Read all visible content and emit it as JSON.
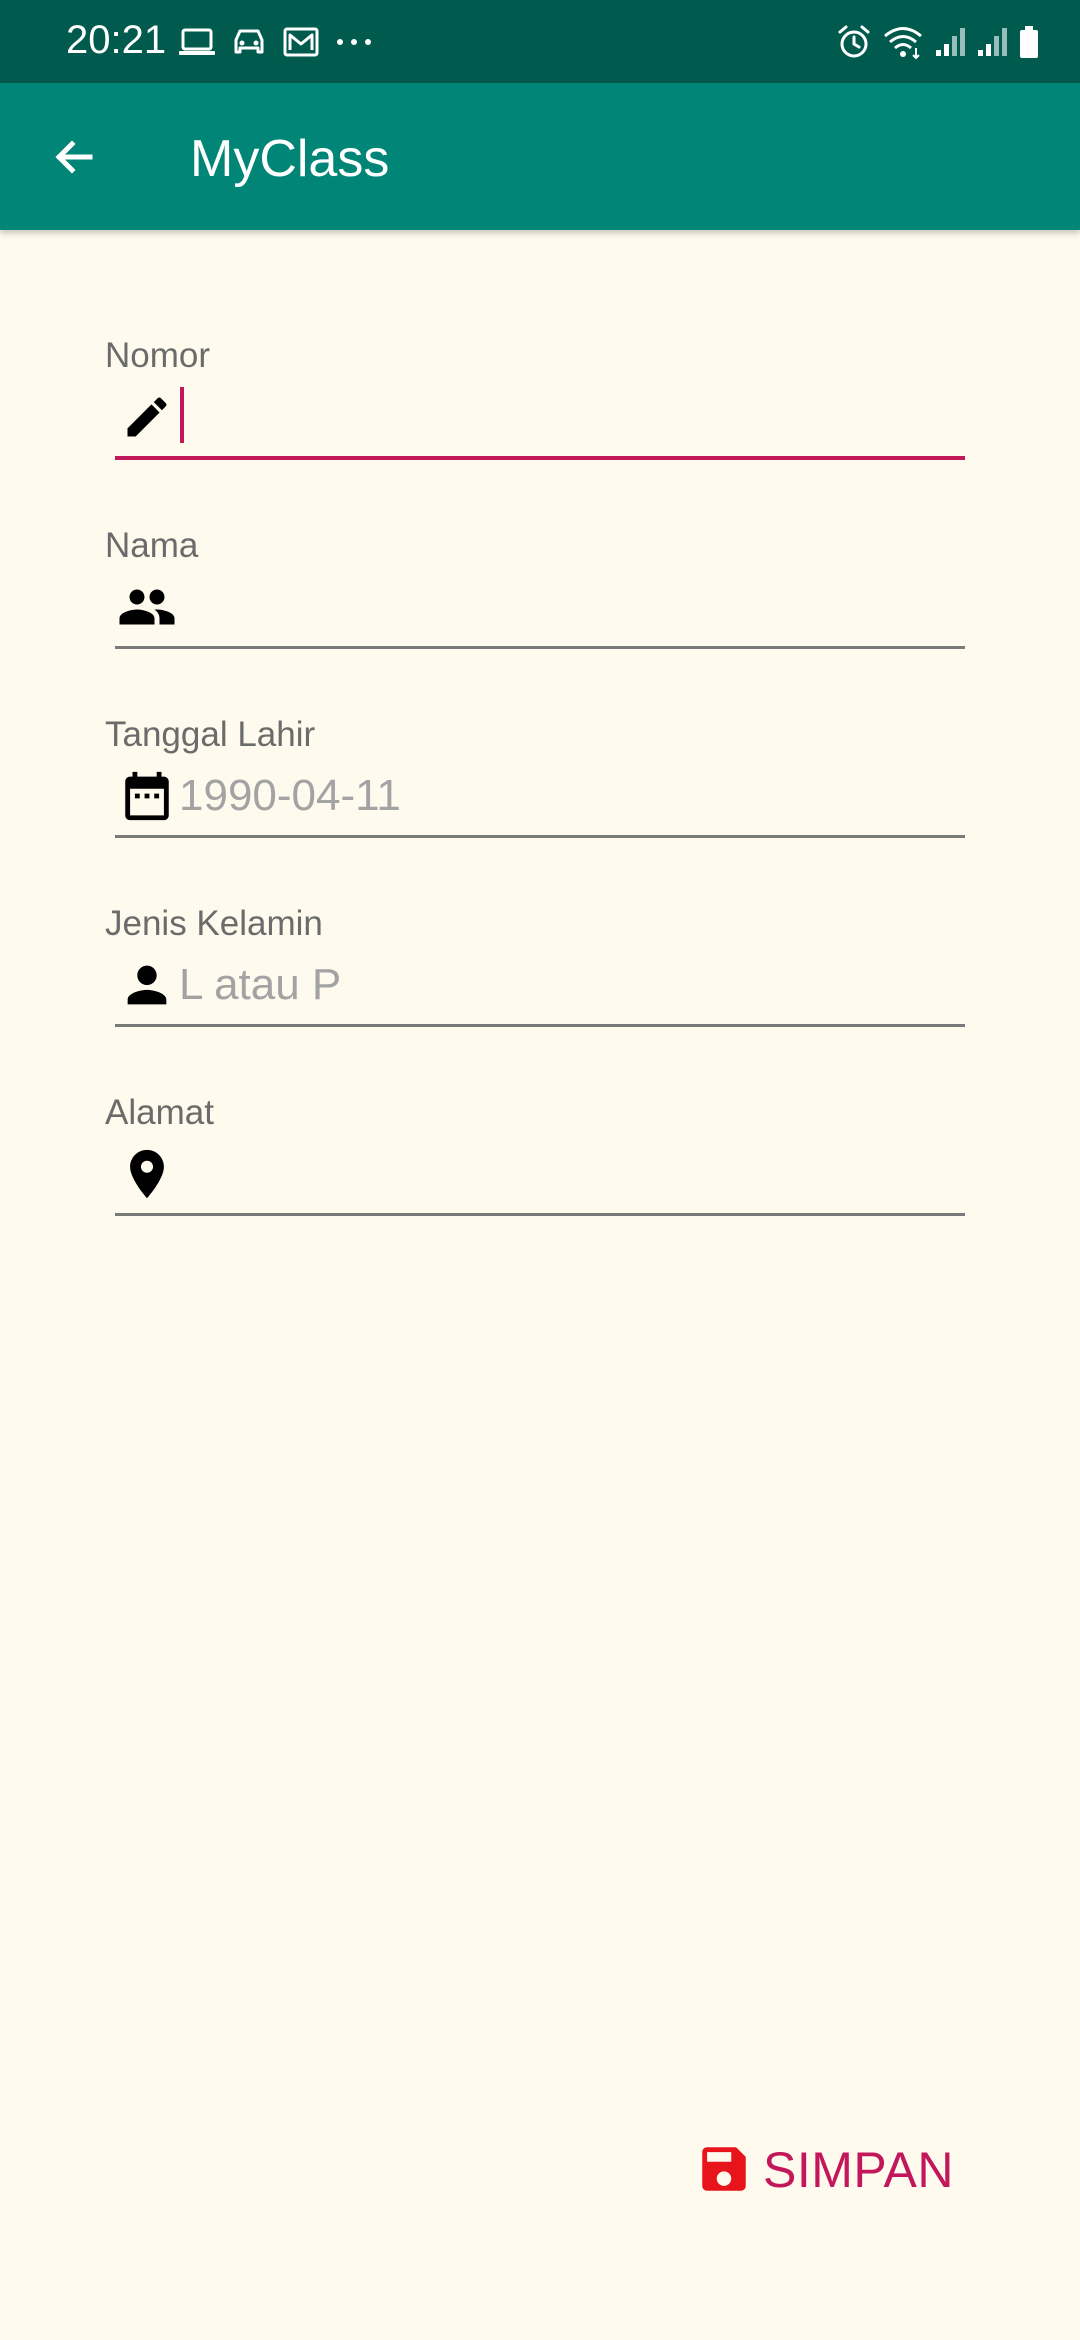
{
  "status_bar": {
    "time": "20:21",
    "left_icons": [
      "laptop-icon",
      "car-icon",
      "gmail-icon",
      "more-dots-icon"
    ],
    "right_icons": [
      "alarm-icon",
      "wifi-icon",
      "signal-icon",
      "signal-icon",
      "battery-icon"
    ],
    "background_color": "#005a4e"
  },
  "app_bar": {
    "title": "MyClass",
    "background_color": "#008577",
    "back_icon": "arrow-back-icon"
  },
  "form": {
    "fields": [
      {
        "label": "Nomor",
        "icon": "pencil-icon",
        "value": "",
        "placeholder": "",
        "focused": true
      },
      {
        "label": "Nama",
        "icon": "people-icon",
        "value": "",
        "placeholder": ""
      },
      {
        "label": "Tanggal Lahir",
        "icon": "calendar-icon",
        "value": "",
        "placeholder": "1990-04-11"
      },
      {
        "label": "Jenis Kelamin",
        "icon": "person-icon",
        "value": "",
        "placeholder": "L atau P"
      },
      {
        "label": "Alamat",
        "icon": "location-pin-icon",
        "value": "",
        "placeholder": ""
      }
    ]
  },
  "save_button": {
    "label": "SIMPAN",
    "icon": "save-icon",
    "label_color": "#c2185b",
    "icon_color": "#e8141c"
  },
  "colors": {
    "background": "#fffaee",
    "accent": "#c2185b",
    "label": "#6b6b6b",
    "placeholder": "#a3a3a3"
  }
}
